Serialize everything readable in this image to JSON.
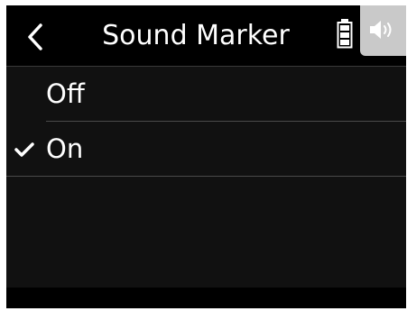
{
  "header": {
    "back_icon": "chevron-left-icon",
    "title": "Sound Marker",
    "battery_icon": "battery-icon",
    "speaker_icon": "speaker-icon"
  },
  "options": [
    {
      "label": "Off",
      "selected": false
    },
    {
      "label": "On",
      "selected": true
    }
  ],
  "colors": {
    "background": "#111111",
    "header": "#000000",
    "text": "#ffffff",
    "divider": "#4a4a4a",
    "speaker_tab": "#c9c9c9"
  }
}
